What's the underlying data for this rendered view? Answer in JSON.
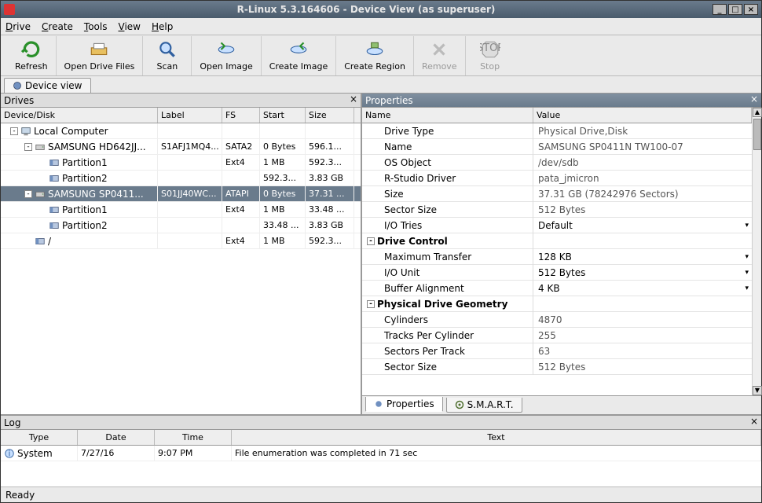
{
  "titlebar": {
    "text": "R-Linux 5.3.164606 - Device View (as superuser)"
  },
  "menu": {
    "drive": "Drive",
    "create": "Create",
    "tools": "Tools",
    "view": "View",
    "help": "Help"
  },
  "toolbar": {
    "refresh": "Refresh",
    "open_drive": "Open Drive Files",
    "scan": "Scan",
    "open_image": "Open Image",
    "create_image": "Create Image",
    "create_region": "Create Region",
    "remove": "Remove",
    "stop": "Stop"
  },
  "view_tab": "Device view",
  "drives_panel_title": "Drives",
  "drives_header": {
    "device": "Device/Disk",
    "label": "Label",
    "fs": "FS",
    "start": "Start",
    "size": "Size"
  },
  "drives_tree": [
    {
      "indent": 0,
      "toggle": "-",
      "icon": "computer",
      "name": "Local Computer",
      "label": "",
      "fs": "",
      "start": "",
      "size": "",
      "sel": false
    },
    {
      "indent": 1,
      "toggle": "-",
      "icon": "drive",
      "name": "SAMSUNG HD642JJ...",
      "label": "S1AFJ1MQ4...",
      "fs": "SATA2",
      "start": "0 Bytes",
      "size": "596.1...",
      "sel": false
    },
    {
      "indent": 2,
      "toggle": "",
      "icon": "part",
      "name": "Partition1",
      "label": "",
      "fs": "Ext4",
      "start": "1 MB",
      "size": "592.3...",
      "sel": false
    },
    {
      "indent": 2,
      "toggle": "",
      "icon": "part",
      "name": "Partition2",
      "label": "",
      "fs": "",
      "start": "592.3...",
      "size": "3.83 GB",
      "sel": false
    },
    {
      "indent": 1,
      "toggle": "-",
      "icon": "drive",
      "name": "SAMSUNG SP0411...",
      "label": "S01JJ40WC...",
      "fs": "ATAPI",
      "start": "0 Bytes",
      "size": "37.31 ...",
      "sel": true
    },
    {
      "indent": 2,
      "toggle": "",
      "icon": "part",
      "name": "Partition1",
      "label": "",
      "fs": "Ext4",
      "start": "1 MB",
      "size": "33.48 ...",
      "sel": false
    },
    {
      "indent": 2,
      "toggle": "",
      "icon": "part",
      "name": "Partition2",
      "label": "",
      "fs": "",
      "start": "33.48 ...",
      "size": "3.83 GB",
      "sel": false
    },
    {
      "indent": 1,
      "toggle": "",
      "icon": "part",
      "name": "/",
      "label": "",
      "fs": "Ext4",
      "start": "1 MB",
      "size": "592.3...",
      "sel": false
    }
  ],
  "props_title": "Properties",
  "props_header": {
    "name": "Name",
    "value": "Value"
  },
  "props": [
    {
      "group": false,
      "name": "Drive Type",
      "value": "Physical Drive,Disk",
      "editable": false,
      "indent": 1
    },
    {
      "group": false,
      "name": "Name",
      "value": "SAMSUNG SP0411N TW100-07",
      "editable": false,
      "indent": 1
    },
    {
      "group": false,
      "name": "OS Object",
      "value": "/dev/sdb",
      "editable": false,
      "indent": 1
    },
    {
      "group": false,
      "name": "R-Studio Driver",
      "value": "pata_jmicron",
      "editable": false,
      "indent": 1
    },
    {
      "group": false,
      "name": "Size",
      "value": "37.31 GB (78242976 Sectors)",
      "editable": false,
      "indent": 1
    },
    {
      "group": false,
      "name": "Sector Size",
      "value": "512 Bytes",
      "editable": false,
      "indent": 1
    },
    {
      "group": false,
      "name": "I/O Tries",
      "value": "Default",
      "editable": true,
      "dropdown": true,
      "indent": 1
    },
    {
      "group": true,
      "name": "Drive Control",
      "value": "",
      "toggle": "-",
      "indent": 0
    },
    {
      "group": false,
      "name": "Maximum Transfer",
      "value": "128 KB",
      "editable": true,
      "dropdown": true,
      "indent": 1
    },
    {
      "group": false,
      "name": "I/O Unit",
      "value": "512 Bytes",
      "editable": true,
      "dropdown": true,
      "indent": 1
    },
    {
      "group": false,
      "name": "Buffer Alignment",
      "value": "4 KB",
      "editable": true,
      "dropdown": true,
      "indent": 1
    },
    {
      "group": true,
      "name": "Physical Drive Geometry",
      "value": "",
      "toggle": "-",
      "indent": 0
    },
    {
      "group": false,
      "name": "Cylinders",
      "value": "4870",
      "editable": false,
      "indent": 1
    },
    {
      "group": false,
      "name": "Tracks Per Cylinder",
      "value": "255",
      "editable": false,
      "indent": 1
    },
    {
      "group": false,
      "name": "Sectors Per Track",
      "value": "63",
      "editable": false,
      "indent": 1
    },
    {
      "group": false,
      "name": "Sector Size",
      "value": "512 Bytes",
      "editable": false,
      "indent": 1
    }
  ],
  "prop_tabs": {
    "properties": "Properties",
    "smart": "S.M.A.R.T."
  },
  "log_title": "Log",
  "log_header": {
    "type": "Type",
    "date": "Date",
    "time": "Time",
    "text": "Text"
  },
  "log_rows": [
    {
      "type": "System",
      "date": "7/27/16",
      "time": "9:07 PM",
      "text": "File enumeration was completed in 71 sec"
    }
  ],
  "status": "Ready"
}
